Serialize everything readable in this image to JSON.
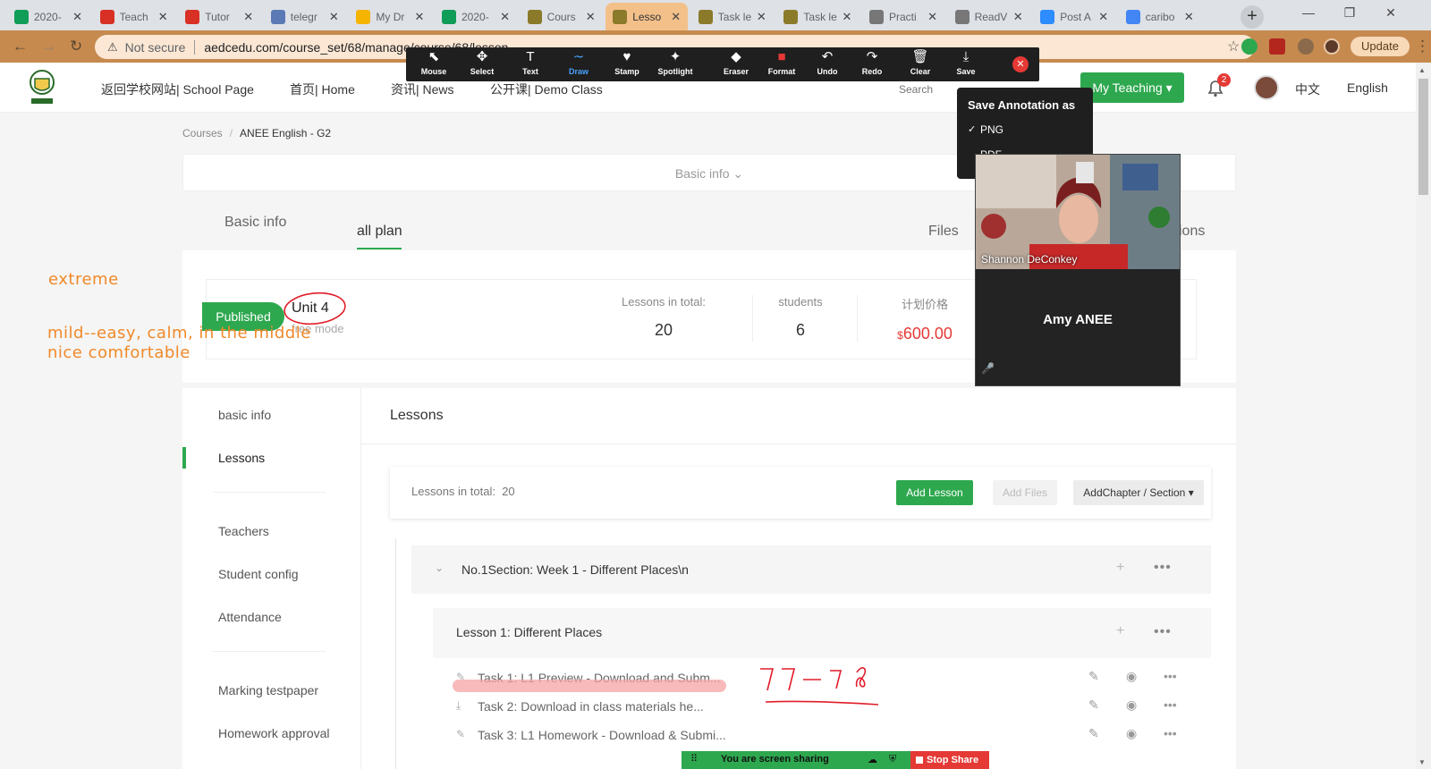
{
  "browser": {
    "tabs": [
      {
        "title": "2020-",
        "icon": "sheets-icon",
        "color": "#0f9d58"
      },
      {
        "title": "Teach",
        "icon": "info-icon",
        "color": "#d93025"
      },
      {
        "title": "Tutor",
        "icon": "info-icon",
        "color": "#d93025"
      },
      {
        "title": "telegr",
        "icon": "telegram-icon",
        "color": "#5a79b5"
      },
      {
        "title": "My Dr",
        "icon": "drive-icon",
        "color": "#f4b400"
      },
      {
        "title": "2020-",
        "icon": "sheets-icon",
        "color": "#0f9d58"
      },
      {
        "title": "Cours",
        "icon": "site-icon",
        "color": "#8a7a2a"
      },
      {
        "title": "Lesso",
        "icon": "site-icon",
        "color": "#8a7a2a"
      },
      {
        "title": "Task le",
        "icon": "site-icon",
        "color": "#8a7a2a"
      },
      {
        "title": "Task le",
        "icon": "site-icon",
        "color": "#8a7a2a"
      },
      {
        "title": "Practi",
        "icon": "globe-icon",
        "color": "#777777"
      },
      {
        "title": "ReadV",
        "icon": "globe-icon",
        "color": "#777777"
      },
      {
        "title": "Post A",
        "icon": "zoom-icon",
        "color": "#2d8cff"
      },
      {
        "title": "caribo",
        "icon": "google-icon",
        "color": "#4285f4"
      }
    ],
    "active_tab": 7,
    "not_secure": "Not secure",
    "url": "aedcedu.com/course_set/68/manage/course/68/lesson",
    "update_label": "Update"
  },
  "header": {
    "nav": [
      "返回学校网站| School Page",
      "首页| Home",
      "资讯| News",
      "公开课| Demo Class"
    ],
    "search_placeholder": "Search",
    "my_teaching": "My Teaching",
    "notification_count": "2",
    "lang_cn": "中文",
    "lang_en": "English"
  },
  "breadcrumb": {
    "root": "Courses",
    "separator": "/",
    "current": "ANEE English - G2"
  },
  "basic_info_bar": "Basic info",
  "page_tabs": {
    "basic_info": "Basic info",
    "all_plan": "all plan",
    "files": "Files",
    "questions_partial": "ions"
  },
  "summary": {
    "status": "Published",
    "unit_title": "Unit 4",
    "unit_subtitle": "free mode",
    "lessons_label": "Lessons in total:",
    "lessons_value": "20",
    "students_label": "students",
    "students_value": "6",
    "price_label": "计划价格",
    "price_currency": "$",
    "price_value": "600.00"
  },
  "sidebar": {
    "items": [
      "basic info",
      "Lessons",
      "Teachers",
      "Student config",
      "Attendance",
      "Marking testpaper",
      "Homework approval"
    ],
    "active_index": 1
  },
  "lessons": {
    "title": "Lessons",
    "total_label": "Lessons in total:",
    "total_value": "20",
    "add_lesson": "Add Lesson",
    "add_files": "Add Files",
    "add_chapter": "AddChapter / Section",
    "section": "No.1Section:  Week 1 - Different Places\\n",
    "lesson": "Lesson 1:   Different Places",
    "tasks": [
      "Task 1:   L1 Preview - Download and Subm...",
      "Task 2:   Download in class materials he...",
      "Task 3:   L1 Homework - Download & Submi..."
    ]
  },
  "annotations": {
    "extreme": "extreme",
    "mild_line1": "mild--easy, calm, in the middle",
    "mild_line2": "nice comfortable",
    "handwritten": "77-78",
    "annotation_color": "#f0892a",
    "ink_color": "#e11d2a"
  },
  "zoom": {
    "tools": [
      {
        "label": "Mouse",
        "icon": "mouse-pointer-icon",
        "glyph": "⬉"
      },
      {
        "label": "Select",
        "icon": "select-move-icon",
        "glyph": "✥"
      },
      {
        "label": "Text",
        "icon": "text-icon",
        "glyph": "T"
      },
      {
        "label": "Draw",
        "icon": "draw-icon",
        "glyph": "∼"
      },
      {
        "label": "Stamp",
        "icon": "stamp-heart-icon",
        "glyph": "♥"
      },
      {
        "label": "Spotlight",
        "icon": "spotlight-icon",
        "glyph": "✦"
      },
      {
        "label": "Eraser",
        "icon": "eraser-icon",
        "glyph": "◆"
      },
      {
        "label": "Format",
        "icon": "format-icon",
        "glyph": "■"
      },
      {
        "label": "Undo",
        "icon": "undo-icon",
        "glyph": "↶"
      },
      {
        "label": "Redo",
        "icon": "redo-icon",
        "glyph": "↷"
      },
      {
        "label": "Clear",
        "icon": "trash-icon",
        "glyph": "🗑"
      },
      {
        "label": "Save",
        "icon": "save-icon",
        "glyph": "⤓"
      }
    ],
    "active_tool": "Draw",
    "save_menu": {
      "title": "Save Annotation as",
      "options": [
        "PNG",
        "PDF"
      ],
      "selected": "PNG"
    },
    "video": {
      "participant_1": "Shannon DeConkey",
      "participant_2": "Amy ANEE"
    },
    "share_text": "You are screen sharing",
    "stop_share": "Stop Share"
  }
}
